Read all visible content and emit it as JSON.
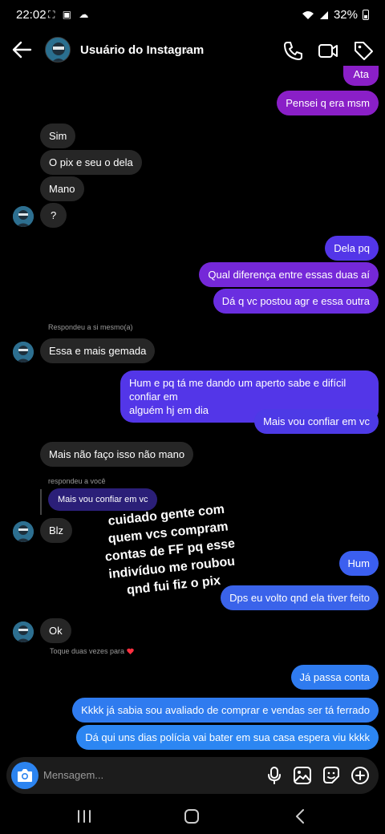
{
  "status": {
    "time": "22:02",
    "left_icons": "⛶ ▣ ☁",
    "battery": "32%"
  },
  "header": {
    "title": "Usuário do Instagram",
    "chevron": "›"
  },
  "messages": {
    "m1": "Ata",
    "m2": "Pensei q era msm",
    "m3": "Sim",
    "m4": "O pix e seu o dela",
    "m5": "Mano",
    "m6": "?",
    "m7": "Dela pq",
    "m8": "Qual diferença entre essas duas aí",
    "m9": "Dá q vc postou agr e essa outra",
    "reply_meta_1": "Respondeu a si mesmo(a)",
    "m10": "Essa e mais gemada",
    "m11_line1": "Hum e pq tá me dando um aperto sabe e difícil confiar em",
    "m11_line2": "alguém hj em dia",
    "m12": "Mais vou confiar em vc",
    "m13": "Mais não faço isso não mano",
    "reply_meta_2": "respondeu a você",
    "reply_quote": "Mais vou confiar em vc",
    "m14": "Blz",
    "m15": "Hum",
    "m16": "Dps eu volto qnd ela tiver feito",
    "m17": "Ok",
    "double_tap_hint": "Toque duas vezes para",
    "m18": "Já passa conta",
    "m19": "Kkkk já sabia sou avaliado de comprar e vendas ser tá ferrado",
    "m20": "Dá qui uns dias polícia vai bater em sua casa espera viu kkkk"
  },
  "overlay": {
    "line1": "cuidado gente com",
    "line2": "quem vcs compram",
    "line3": "contas de FF pq esse",
    "line4": "indivíduo me roubou",
    "line5": "qnd fui fiz o pix"
  },
  "composer": {
    "placeholder": "Mensagem..."
  },
  "icons": [
    "back-arrow-icon",
    "phone-icon",
    "video-icon",
    "tag-icon",
    "camera-icon",
    "microphone-icon",
    "gallery-icon",
    "sticker-icon",
    "plus-icon",
    "heart-icon"
  ],
  "colors": {
    "accent_blue": "#2f7bef",
    "accent_purple": "#8a1fc7",
    "incoming": "#262626"
  }
}
